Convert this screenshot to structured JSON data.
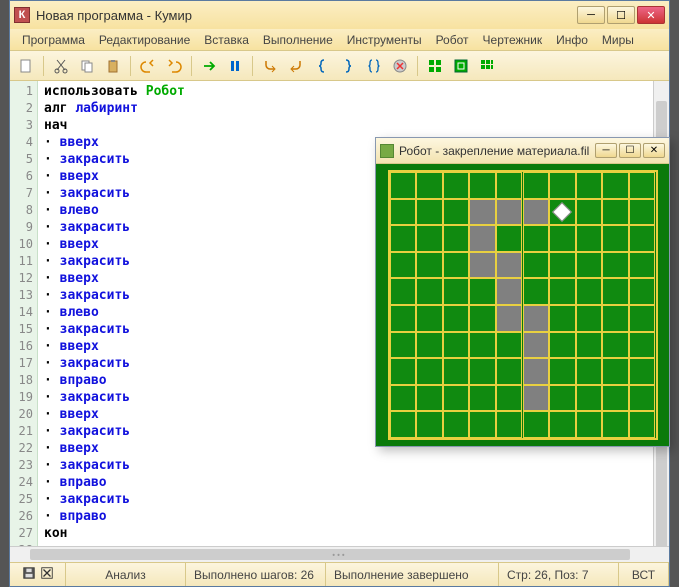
{
  "window": {
    "title": "Новая программа - Кумир",
    "app_letter": "К"
  },
  "menu": [
    "Программа",
    "Редактирование",
    "Вставка",
    "Выполнение",
    "Инструменты",
    "Робот",
    "Чертежник",
    "Инфо",
    "Миры"
  ],
  "code": {
    "lines": [
      {
        "n": 1,
        "segs": [
          {
            "t": "использовать ",
            "c": "kw-black"
          },
          {
            "t": "Робот",
            "c": "kw-green"
          }
        ]
      },
      {
        "n": 2,
        "segs": [
          {
            "t": "алг ",
            "c": "kw-black"
          },
          {
            "t": "лабиринт",
            "c": "kw-blue"
          }
        ]
      },
      {
        "n": 3,
        "segs": [
          {
            "t": "нач",
            "c": "kw-black"
          }
        ]
      },
      {
        "n": 4,
        "segs": [
          {
            "t": "· ",
            "c": "dot"
          },
          {
            "t": "вверх",
            "c": "kw-blue"
          }
        ]
      },
      {
        "n": 5,
        "segs": [
          {
            "t": "· ",
            "c": "dot"
          },
          {
            "t": "закрасить",
            "c": "kw-blue"
          }
        ]
      },
      {
        "n": 6,
        "segs": [
          {
            "t": "· ",
            "c": "dot"
          },
          {
            "t": "вверх",
            "c": "kw-blue"
          }
        ]
      },
      {
        "n": 7,
        "segs": [
          {
            "t": "· ",
            "c": "dot"
          },
          {
            "t": "закрасить",
            "c": "kw-blue"
          }
        ]
      },
      {
        "n": 8,
        "segs": [
          {
            "t": "· ",
            "c": "dot"
          },
          {
            "t": "влево",
            "c": "kw-blue"
          }
        ]
      },
      {
        "n": 9,
        "segs": [
          {
            "t": "· ",
            "c": "dot"
          },
          {
            "t": "закрасить",
            "c": "kw-blue"
          }
        ]
      },
      {
        "n": 10,
        "segs": [
          {
            "t": "· ",
            "c": "dot"
          },
          {
            "t": "вверх",
            "c": "kw-blue"
          }
        ]
      },
      {
        "n": 11,
        "segs": [
          {
            "t": "· ",
            "c": "dot"
          },
          {
            "t": "закрасить",
            "c": "kw-blue"
          }
        ]
      },
      {
        "n": 12,
        "segs": [
          {
            "t": "· ",
            "c": "dot"
          },
          {
            "t": "вверх",
            "c": "kw-blue"
          }
        ]
      },
      {
        "n": 13,
        "segs": [
          {
            "t": "· ",
            "c": "dot"
          },
          {
            "t": "закрасить",
            "c": "kw-blue"
          }
        ]
      },
      {
        "n": 14,
        "segs": [
          {
            "t": "· ",
            "c": "dot"
          },
          {
            "t": "влево",
            "c": "kw-blue"
          }
        ]
      },
      {
        "n": 15,
        "segs": [
          {
            "t": "· ",
            "c": "dot"
          },
          {
            "t": "закрасить",
            "c": "kw-blue"
          }
        ]
      },
      {
        "n": 16,
        "segs": [
          {
            "t": "· ",
            "c": "dot"
          },
          {
            "t": "вверх",
            "c": "kw-blue"
          }
        ]
      },
      {
        "n": 17,
        "segs": [
          {
            "t": "· ",
            "c": "dot"
          },
          {
            "t": "закрасить",
            "c": "kw-blue"
          }
        ]
      },
      {
        "n": 18,
        "segs": [
          {
            "t": "· ",
            "c": "dot"
          },
          {
            "t": "вправо",
            "c": "kw-blue"
          }
        ]
      },
      {
        "n": 19,
        "segs": [
          {
            "t": "· ",
            "c": "dot"
          },
          {
            "t": "закрасить",
            "c": "kw-blue"
          }
        ]
      },
      {
        "n": 20,
        "segs": [
          {
            "t": "· ",
            "c": "dot"
          },
          {
            "t": "вверх",
            "c": "kw-blue"
          }
        ]
      },
      {
        "n": 21,
        "segs": [
          {
            "t": "· ",
            "c": "dot"
          },
          {
            "t": "закрасить",
            "c": "kw-blue"
          }
        ]
      },
      {
        "n": 22,
        "segs": [
          {
            "t": "· ",
            "c": "dot"
          },
          {
            "t": "вверх",
            "c": "kw-blue"
          }
        ]
      },
      {
        "n": 23,
        "segs": [
          {
            "t": "· ",
            "c": "dot"
          },
          {
            "t": "закрасить",
            "c": "kw-blue"
          }
        ]
      },
      {
        "n": 24,
        "segs": [
          {
            "t": "· ",
            "c": "dot"
          },
          {
            "t": "вправо",
            "c": "kw-blue"
          }
        ]
      },
      {
        "n": 25,
        "segs": [
          {
            "t": "· ",
            "c": "dot"
          },
          {
            "t": "закрасить",
            "c": "kw-blue"
          }
        ]
      },
      {
        "n": 26,
        "segs": [
          {
            "t": "· ",
            "c": "dot"
          },
          {
            "t": "вправо",
            "c": "kw-blue"
          }
        ]
      },
      {
        "n": 27,
        "segs": [
          {
            "t": "кон",
            "c": "kw-black"
          }
        ]
      },
      {
        "n": 28,
        "segs": []
      }
    ]
  },
  "status": {
    "analysis": "Анализ",
    "steps": "Выполнено шагов: 26",
    "state": "Выполнение завершено",
    "pos": "Стр: 26, Поз: 7",
    "mode": "ВСТ"
  },
  "robot": {
    "title": "Робот - закрепление материала.fil",
    "grid": {
      "cols": 10,
      "rows": 10
    },
    "painted": [
      {
        "r": 1,
        "c": 3
      },
      {
        "r": 1,
        "c": 4
      },
      {
        "r": 1,
        "c": 5
      },
      {
        "r": 2,
        "c": 3
      },
      {
        "r": 3,
        "c": 3
      },
      {
        "r": 3,
        "c": 4
      },
      {
        "r": 4,
        "c": 4
      },
      {
        "r": 5,
        "c": 4
      },
      {
        "r": 5,
        "c": 5
      },
      {
        "r": 6,
        "c": 5
      },
      {
        "r": 7,
        "c": 5
      },
      {
        "r": 8,
        "c": 5
      }
    ],
    "robot_pos": {
      "r": 1,
      "c": 6
    }
  }
}
